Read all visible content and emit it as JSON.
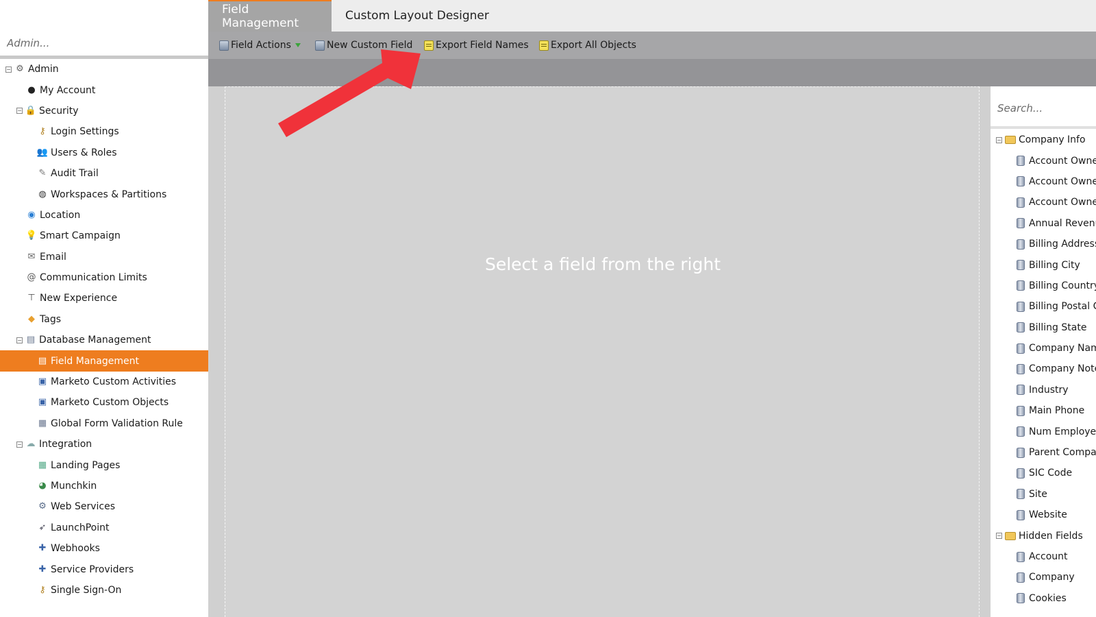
{
  "sidebar": {
    "search_placeholder": "Admin...",
    "tree": [
      {
        "label": "Admin",
        "icon": "gear-icon",
        "level": 0,
        "expanded": true
      },
      {
        "label": "My Account",
        "icon": "user-icon",
        "level": 1
      },
      {
        "label": "Security",
        "icon": "lock-icon",
        "level": 1,
        "expanded": true
      },
      {
        "label": "Login Settings",
        "icon": "key-icon",
        "level": 2
      },
      {
        "label": "Users & Roles",
        "icon": "users-icon",
        "level": 2
      },
      {
        "label": "Audit Trail",
        "icon": "audit-icon",
        "level": 2
      },
      {
        "label": "Workspaces & Partitions",
        "icon": "globe-icon",
        "level": 2
      },
      {
        "label": "Location",
        "icon": "location-icon",
        "level": 1
      },
      {
        "label": "Smart Campaign",
        "icon": "lightbulb-icon",
        "level": 1
      },
      {
        "label": "Email",
        "icon": "email-icon",
        "level": 1
      },
      {
        "label": "Communication Limits",
        "icon": "at-icon",
        "level": 1
      },
      {
        "label": "New Experience",
        "icon": "signpost-icon",
        "level": 1
      },
      {
        "label": "Tags",
        "icon": "tag-icon",
        "level": 1
      },
      {
        "label": "Database Management",
        "icon": "database-icon",
        "level": 1,
        "expanded": true
      },
      {
        "label": "Field Management",
        "icon": "field-icon",
        "level": 2,
        "active": true
      },
      {
        "label": "Marketo Custom Activities",
        "icon": "custom-activity-icon",
        "level": 2
      },
      {
        "label": "Marketo Custom Objects",
        "icon": "custom-object-icon",
        "level": 2
      },
      {
        "label": "Global Form Validation Rule",
        "icon": "form-icon",
        "level": 2
      },
      {
        "label": "Integration",
        "icon": "cloud-icon",
        "level": 1,
        "expanded": true
      },
      {
        "label": "Landing Pages",
        "icon": "landing-page-icon",
        "level": 2
      },
      {
        "label": "Munchkin",
        "icon": "munchkin-icon",
        "level": 2
      },
      {
        "label": "Web Services",
        "icon": "web-services-icon",
        "level": 2
      },
      {
        "label": "LaunchPoint",
        "icon": "rocket-icon",
        "level": 2
      },
      {
        "label": "Webhooks",
        "icon": "webhook-icon",
        "level": 2
      },
      {
        "label": "Service Providers",
        "icon": "plug-icon",
        "level": 2
      },
      {
        "label": "Single Sign-On",
        "icon": "key-icon",
        "level": 2
      }
    ]
  },
  "tabs": {
    "field_management": "Field Management",
    "custom_layout_designer": "Custom Layout Designer"
  },
  "toolbar": {
    "field_actions": "Field Actions",
    "new_custom_field": "New Custom Field",
    "export_field_names": "Export Field Names",
    "export_all_objects": "Export All Objects"
  },
  "canvas": {
    "message": "Select a field from the right"
  },
  "field_panel": {
    "search_placeholder": "Search...",
    "rows": [
      {
        "label": "Company Info",
        "type": "group"
      },
      {
        "label": "Account Owner",
        "type": "item"
      },
      {
        "label": "Account Owner Email",
        "type": "item"
      },
      {
        "label": "Account Owner Name",
        "type": "item"
      },
      {
        "label": "Annual Revenue",
        "type": "item"
      },
      {
        "label": "Billing Address",
        "type": "item"
      },
      {
        "label": "Billing City",
        "type": "item"
      },
      {
        "label": "Billing Country",
        "type": "item"
      },
      {
        "label": "Billing Postal Code",
        "type": "item"
      },
      {
        "label": "Billing State",
        "type": "item"
      },
      {
        "label": "Company Name",
        "type": "item"
      },
      {
        "label": "Company Notes",
        "type": "item"
      },
      {
        "label": "Industry",
        "type": "item"
      },
      {
        "label": "Main Phone",
        "type": "item"
      },
      {
        "label": "Num Employees",
        "type": "item"
      },
      {
        "label": "Parent Company",
        "type": "item"
      },
      {
        "label": "SIC Code",
        "type": "item"
      },
      {
        "label": "Site",
        "type": "item"
      },
      {
        "label": "Website",
        "type": "item"
      },
      {
        "label": "Hidden Fields",
        "type": "group"
      },
      {
        "label": "Account",
        "type": "item"
      },
      {
        "label": "Company",
        "type": "item"
      },
      {
        "label": "Cookies",
        "type": "item"
      }
    ]
  },
  "colors": {
    "accent": "#ee7d1f",
    "toolbar": "#a6a6a8",
    "canvas": "#d3d3d3",
    "annotation_arrow": "#f0323a"
  }
}
